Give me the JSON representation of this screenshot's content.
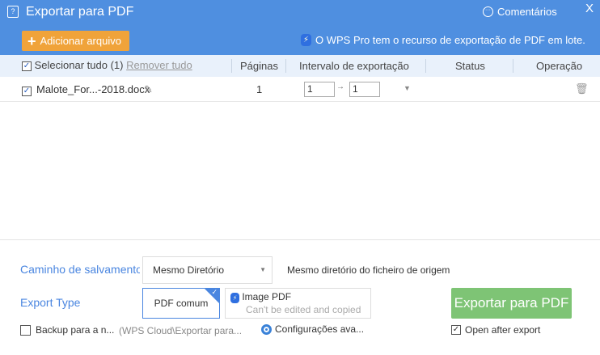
{
  "window": {
    "title": "Exportar para PDF",
    "comments": "Comentários",
    "close": "X"
  },
  "toolbar": {
    "add_file": "Adicionar arquivo",
    "pro_notice": "O WPS Pro tem o recurso de exportação de PDF em lote."
  },
  "table": {
    "select_all": "Selecionar tudo (1)",
    "remove_all": "Remover tudo",
    "columns": [
      "Páginas",
      "Intervalo de exportação",
      "Status",
      "Operação"
    ],
    "rows": [
      {
        "name": "Malote_For...-2018.docx",
        "pages": "1",
        "from": "1",
        "to": "1",
        "status": ""
      }
    ]
  },
  "options": {
    "save_path_label": "Caminho de salvamento",
    "save_path_value": "Mesmo Diretório",
    "save_path_desc": "Mesmo diretório do ficheiro de origem",
    "export_type_label": "Export Type",
    "type_common": "PDF comum",
    "type_image": "Image PDF",
    "type_image_desc": "Can't be edited and copied",
    "export_button": "Exportar para PDF",
    "backup_label": "Backup para a n...",
    "backup_path": "(WPS Cloud\\Exportar para...",
    "advanced": "Configurações ava...",
    "open_after": "Open after export"
  },
  "colors": {
    "header": "#4f8fe0",
    "add_button": "#f0a33a",
    "export_button": "#7ec475",
    "accent": "#4a86e0"
  }
}
